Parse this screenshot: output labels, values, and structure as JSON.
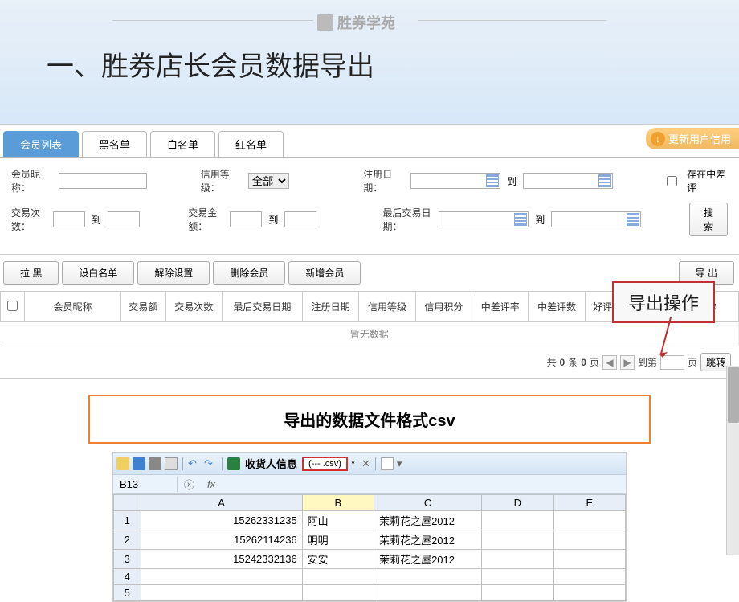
{
  "header": {
    "logo": "胜券学苑",
    "title": "一、胜券店长会员数据导出"
  },
  "tabs": [
    "会员列表",
    "黑名单",
    "白名单",
    "红名单"
  ],
  "update_credit": "更新用户信用",
  "filters": {
    "nickname_label": "会员昵称：",
    "credit_level_label": "信用等级：",
    "credit_level_value": "全部",
    "reg_date_label": "注册日期：",
    "to": "到",
    "exists_bad_label": "存在中差评",
    "trade_count_label": "交易次数：",
    "trade_amount_label": "交易金额：",
    "last_trade_label": "最后交易日期：",
    "search": "搜索"
  },
  "actions": {
    "blacklist": "拉 黑",
    "whitelist": "设白名单",
    "reset": "解除设置",
    "delete": "删除会员",
    "add": "新增会员",
    "export": "导 出"
  },
  "callouts": {
    "export_op": "导出操作",
    "csv_format": "导出的数据文件格式csv"
  },
  "table": {
    "cols": [
      "会员昵称",
      "交易额",
      "交易次数",
      "最后交易日期",
      "注册日期",
      "信用等级",
      "信用积分",
      "中差评率",
      "中差评数",
      "好评数",
      "总评数",
      "操作"
    ],
    "no_data": "暂无数据"
  },
  "pagination": {
    "total_prefix": "共",
    "total_count": "0",
    "total_mid": "条",
    "page_count": "0",
    "total_suffix": "页",
    "goto": "到第",
    "page_suffix": "页",
    "jump": "跳转"
  },
  "excel": {
    "file_label": "收货人信息",
    "csv_tab": "(--- .csv)",
    "cell_ref": "B13",
    "cols": [
      "A",
      "B",
      "C",
      "D",
      "E"
    ],
    "rows": [
      {
        "n": "1",
        "a": "15262331235",
        "b": "阿山",
        "c": "茉莉花之屋2012"
      },
      {
        "n": "2",
        "a": "15262114236",
        "b": "明明",
        "c": "茉莉花之屋2012"
      },
      {
        "n": "3",
        "a": "15242332136",
        "b": "安安",
        "c": "茉莉花之屋2012"
      },
      {
        "n": "4",
        "a": "",
        "b": "",
        "c": ""
      },
      {
        "n": "5",
        "a": "",
        "b": "",
        "c": ""
      }
    ]
  }
}
